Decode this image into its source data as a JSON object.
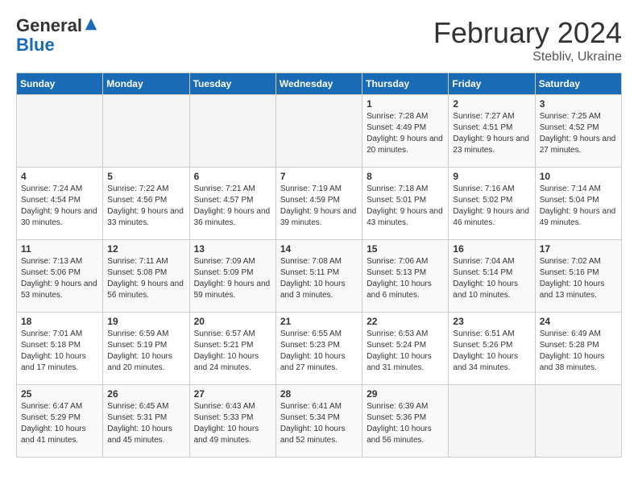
{
  "app": {
    "logo_line1": "General",
    "logo_line2": "Blue"
  },
  "header": {
    "month_year": "February 2024",
    "location": "Stebliv, Ukraine"
  },
  "weekdays": [
    "Sunday",
    "Monday",
    "Tuesday",
    "Wednesday",
    "Thursday",
    "Friday",
    "Saturday"
  ],
  "weeks": [
    [
      {
        "day": "",
        "empty": true
      },
      {
        "day": "",
        "empty": true
      },
      {
        "day": "",
        "empty": true
      },
      {
        "day": "",
        "empty": true
      },
      {
        "day": "1",
        "sunrise": "7:28 AM",
        "sunset": "4:49 PM",
        "daylight": "9 hours and 20 minutes."
      },
      {
        "day": "2",
        "sunrise": "7:27 AM",
        "sunset": "4:51 PM",
        "daylight": "9 hours and 23 minutes."
      },
      {
        "day": "3",
        "sunrise": "7:25 AM",
        "sunset": "4:52 PM",
        "daylight": "9 hours and 27 minutes."
      }
    ],
    [
      {
        "day": "4",
        "sunrise": "7:24 AM",
        "sunset": "4:54 PM",
        "daylight": "9 hours and 30 minutes."
      },
      {
        "day": "5",
        "sunrise": "7:22 AM",
        "sunset": "4:56 PM",
        "daylight": "9 hours and 33 minutes."
      },
      {
        "day": "6",
        "sunrise": "7:21 AM",
        "sunset": "4:57 PM",
        "daylight": "9 hours and 36 minutes."
      },
      {
        "day": "7",
        "sunrise": "7:19 AM",
        "sunset": "4:59 PM",
        "daylight": "9 hours and 39 minutes."
      },
      {
        "day": "8",
        "sunrise": "7:18 AM",
        "sunset": "5:01 PM",
        "daylight": "9 hours and 43 minutes."
      },
      {
        "day": "9",
        "sunrise": "7:16 AM",
        "sunset": "5:02 PM",
        "daylight": "9 hours and 46 minutes."
      },
      {
        "day": "10",
        "sunrise": "7:14 AM",
        "sunset": "5:04 PM",
        "daylight": "9 hours and 49 minutes."
      }
    ],
    [
      {
        "day": "11",
        "sunrise": "7:13 AM",
        "sunset": "5:06 PM",
        "daylight": "9 hours and 53 minutes."
      },
      {
        "day": "12",
        "sunrise": "7:11 AM",
        "sunset": "5:08 PM",
        "daylight": "9 hours and 56 minutes."
      },
      {
        "day": "13",
        "sunrise": "7:09 AM",
        "sunset": "5:09 PM",
        "daylight": "9 hours and 59 minutes."
      },
      {
        "day": "14",
        "sunrise": "7:08 AM",
        "sunset": "5:11 PM",
        "daylight": "10 hours and 3 minutes."
      },
      {
        "day": "15",
        "sunrise": "7:06 AM",
        "sunset": "5:13 PM",
        "daylight": "10 hours and 6 minutes."
      },
      {
        "day": "16",
        "sunrise": "7:04 AM",
        "sunset": "5:14 PM",
        "daylight": "10 hours and 10 minutes."
      },
      {
        "day": "17",
        "sunrise": "7:02 AM",
        "sunset": "5:16 PM",
        "daylight": "10 hours and 13 minutes."
      }
    ],
    [
      {
        "day": "18",
        "sunrise": "7:01 AM",
        "sunset": "5:18 PM",
        "daylight": "10 hours and 17 minutes."
      },
      {
        "day": "19",
        "sunrise": "6:59 AM",
        "sunset": "5:19 PM",
        "daylight": "10 hours and 20 minutes."
      },
      {
        "day": "20",
        "sunrise": "6:57 AM",
        "sunset": "5:21 PM",
        "daylight": "10 hours and 24 minutes."
      },
      {
        "day": "21",
        "sunrise": "6:55 AM",
        "sunset": "5:23 PM",
        "daylight": "10 hours and 27 minutes."
      },
      {
        "day": "22",
        "sunrise": "6:53 AM",
        "sunset": "5:24 PM",
        "daylight": "10 hours and 31 minutes."
      },
      {
        "day": "23",
        "sunrise": "6:51 AM",
        "sunset": "5:26 PM",
        "daylight": "10 hours and 34 minutes."
      },
      {
        "day": "24",
        "sunrise": "6:49 AM",
        "sunset": "5:28 PM",
        "daylight": "10 hours and 38 minutes."
      }
    ],
    [
      {
        "day": "25",
        "sunrise": "6:47 AM",
        "sunset": "5:29 PM",
        "daylight": "10 hours and 41 minutes."
      },
      {
        "day": "26",
        "sunrise": "6:45 AM",
        "sunset": "5:31 PM",
        "daylight": "10 hours and 45 minutes."
      },
      {
        "day": "27",
        "sunrise": "6:43 AM",
        "sunset": "5:33 PM",
        "daylight": "10 hours and 49 minutes."
      },
      {
        "day": "28",
        "sunrise": "6:41 AM",
        "sunset": "5:34 PM",
        "daylight": "10 hours and 52 minutes."
      },
      {
        "day": "29",
        "sunrise": "6:39 AM",
        "sunset": "5:36 PM",
        "daylight": "10 hours and 56 minutes."
      },
      {
        "day": "",
        "empty": true
      },
      {
        "day": "",
        "empty": true
      }
    ]
  ],
  "labels": {
    "sunrise_prefix": "Sunrise: ",
    "sunset_prefix": "Sunset: ",
    "daylight_prefix": "Daylight: "
  }
}
